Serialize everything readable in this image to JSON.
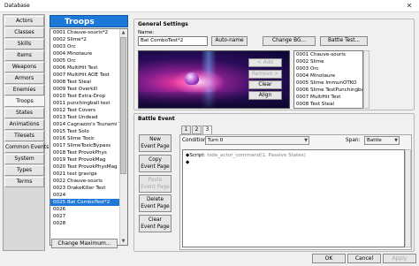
{
  "window": {
    "title": "Database",
    "close_glyph": "✕"
  },
  "categories": [
    {
      "label": "Actors"
    },
    {
      "label": "Classes"
    },
    {
      "label": "Skills"
    },
    {
      "label": "Items"
    },
    {
      "label": "Weapons"
    },
    {
      "label": "Armors"
    },
    {
      "label": "Enemies"
    },
    {
      "label": "Troops"
    },
    {
      "label": "States"
    },
    {
      "label": "Animations"
    },
    {
      "label": "Tilesets"
    },
    {
      "label": "Common Events"
    },
    {
      "label": "System"
    },
    {
      "label": "Types"
    },
    {
      "label": "Terms"
    }
  ],
  "active_category": "Troops",
  "troops": {
    "header": "Troops",
    "items": [
      "0001 Chauve-souris*2",
      "0002 Slime*2",
      "0003 Orc",
      "0004 Minotaure",
      "0005 Orc",
      "0006 MultiHit Test",
      "0007 MultiHit AOE Test",
      "0008 Test Steal",
      "0009 Test Overkill",
      "0010 Test Extra-Drop",
      "0011 punchingball test",
      "0012 Test Covers",
      "0013 Test Undead",
      "0014 Cagnazzo's Tsunami T",
      "0015 Test Solo",
      "0016 Slime Toxic",
      "0017 SlimeToxicBypass",
      "0018 Test ProvokPhys",
      "0019 Test ProvokMag",
      "0020 Test ProvokPhysMag",
      "0021 test graviga",
      "0022 Chauve-souris",
      "0023 DrakeKiller Test",
      "0024",
      "0025 Bat ComboTest*2",
      "0026",
      "0027",
      "0028"
    ],
    "selected_index": 24,
    "change_max_label": "Change Maximum..."
  },
  "general": {
    "title": "General Settings",
    "name_label": "Name:",
    "name_value": "Bat ComboTest*2",
    "autoname_label": "Auto-name",
    "change_bg_label": "Change BG...",
    "battle_test_label": "Battle Test...",
    "add_label": "< Add",
    "remove_label": "Remove >",
    "clear_label": "Clear",
    "align_label": "Align",
    "enemies": [
      "0001 Chauve-souris",
      "0002 Slime",
      "0003 Orc",
      "0004 Minotaure",
      "0005 Slime ImmunOTKO",
      "0006 Slime TestPunchingball",
      "0007 MultiHit Test",
      "0008 Test Steal"
    ]
  },
  "battle_event": {
    "title": "Battle Event",
    "tabs": [
      "1",
      "2",
      "3"
    ],
    "active_tab": "3",
    "page_buttons": {
      "new": [
        "New",
        "Event Page"
      ],
      "copy": [
        "Copy",
        "Event Page"
      ],
      "paste": [
        "Paste",
        "Event Page"
      ],
      "delete": [
        "Delete",
        "Event Page"
      ],
      "clear": [
        "Clear",
        "Event Page"
      ]
    },
    "conditions_label": "Conditions:",
    "conditions_value": "Turn 0",
    "span_label": "Span:",
    "span_value": "Battle",
    "commands": [
      {
        "bullet": "◆",
        "keyword": "Script",
        "arg": ": hide_actor_command(1, Passive States)"
      },
      {
        "bullet": "◆",
        "keyword": "",
        "arg": ""
      }
    ]
  },
  "footer": {
    "ok": "OK",
    "cancel": "Cancel",
    "apply": "Apply"
  }
}
